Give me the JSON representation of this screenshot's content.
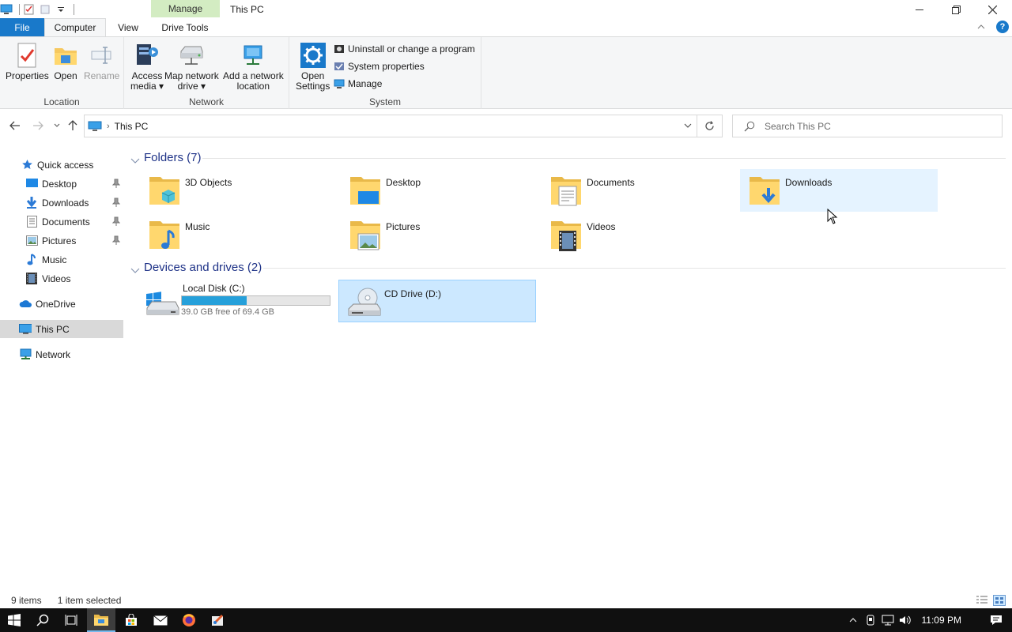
{
  "window": {
    "title": "This PC",
    "context_tab": "Manage"
  },
  "ribbon": {
    "tabs": [
      "File",
      "Computer",
      "View",
      "Drive Tools"
    ],
    "location": {
      "label": "Location",
      "properties": "Properties",
      "open": "Open",
      "rename": "Rename"
    },
    "network": {
      "label": "Network",
      "access_media_l1": "Access",
      "access_media_l2": "media",
      "map_drive_l1": "Map network",
      "map_drive_l2": "drive",
      "add_location_l1": "Add a network",
      "add_location_l2": "location"
    },
    "system": {
      "label": "System",
      "open_settings_l1": "Open",
      "open_settings_l2": "Settings",
      "uninstall": "Uninstall or change a program",
      "system_properties": "System properties",
      "manage": "Manage"
    }
  },
  "address": {
    "crumb": "This PC",
    "search_placeholder": "Search This PC"
  },
  "navpane": {
    "quick_access": "Quick access",
    "items": [
      {
        "label": "Desktop",
        "pinned": true
      },
      {
        "label": "Downloads",
        "pinned": true
      },
      {
        "label": "Documents",
        "pinned": true
      },
      {
        "label": "Pictures",
        "pinned": true
      },
      {
        "label": "Music",
        "pinned": false
      },
      {
        "label": "Videos",
        "pinned": false
      }
    ],
    "onedrive": "OneDrive",
    "this_pc": "This PC",
    "network": "Network"
  },
  "content": {
    "folders_header": "Folders (7)",
    "folders": [
      "3D Objects",
      "Desktop",
      "Documents",
      "Downloads",
      "Music",
      "Pictures",
      "Videos"
    ],
    "drives_header": "Devices and drives (2)",
    "drives": [
      {
        "name": "Local Disk (C:)",
        "free": "39.0 GB free of 69.4 GB",
        "used_fraction": 0.44
      },
      {
        "name": "CD Drive (D:)"
      }
    ]
  },
  "status": {
    "count": "9 items",
    "selected": "1 item selected"
  },
  "taskbar": {
    "clock": "11:09 PM"
  },
  "colors": {
    "accent": "#1979ca",
    "manage_tab": "#d3ecc2",
    "selection": "#cce8ff",
    "drive_bar": "#26a0da"
  }
}
